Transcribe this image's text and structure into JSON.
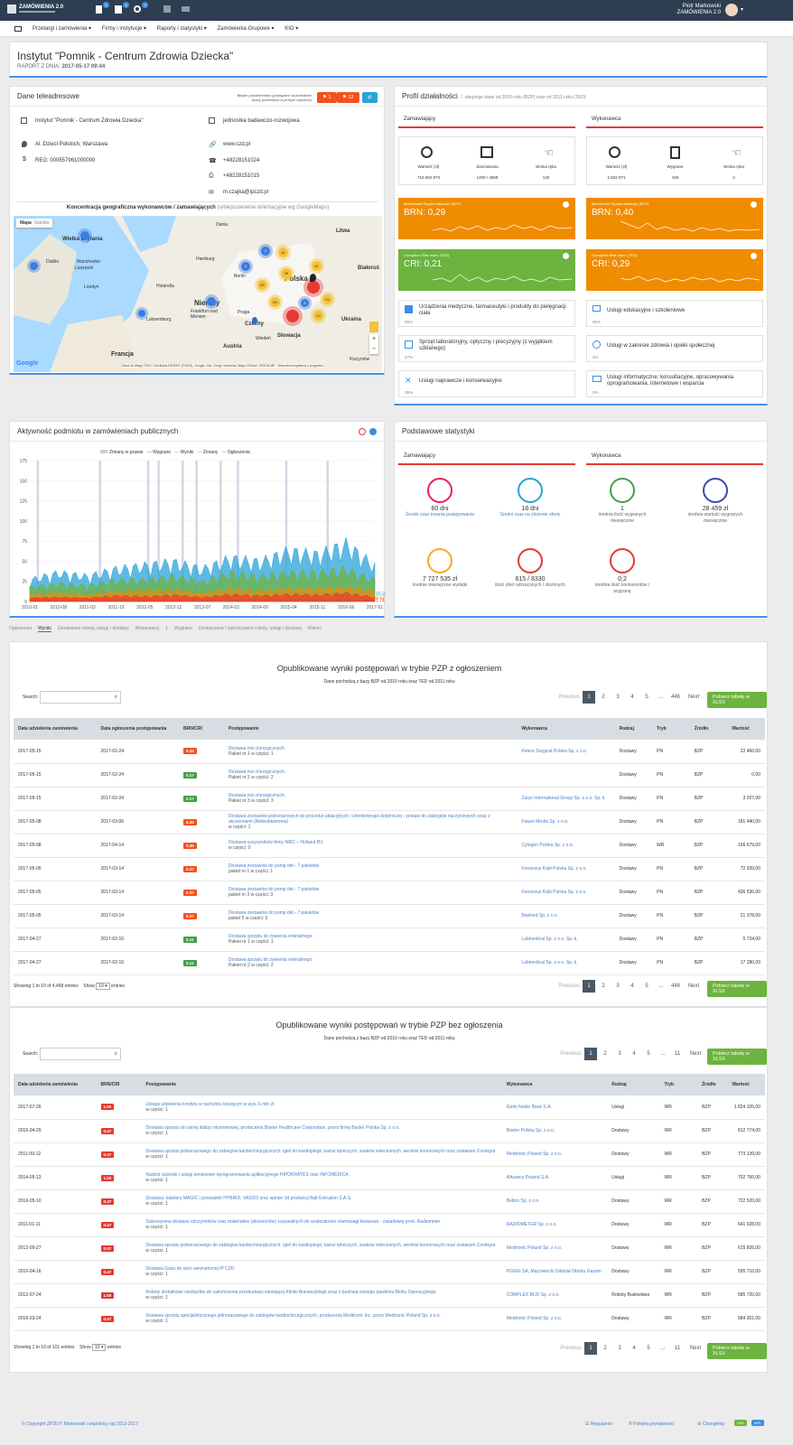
{
  "topbar": {
    "logo": "ZAMÓWIENIA 2.0",
    "user": "Piotr Markowski",
    "user_sub": "ZAMÓWIENIA 2.0",
    "badges": [
      "5",
      "5",
      "9"
    ]
  },
  "nav": [
    "Przetargi i zamówienia",
    "Firmy i instytucje",
    "Raporty i statystyki",
    "Zamówienia Grupowe",
    "KIO"
  ],
  "header": {
    "title": "Instytut \"Pomnik - Centrum Zdrowia Dziecka\"",
    "report_label": "RAPORT Z DNIA:",
    "report_date": "2017-05-17 09:44"
  },
  "contact": {
    "title": "Dane teleadresowe",
    "related_label": "Bliskie podobieństwo (powiązani na podstawie liczby podmiotów w jednym rejestrze)",
    "btn1": "1",
    "btn2": "12",
    "name": "Instytut \"Pomnik - Centrum Zdrowia Dziecka\"",
    "type": "jednostka badawczo-rozwojowa",
    "address": "Al. Dzieci Polskich, Warszawa",
    "www": "www.czd.pl",
    "regon": "REG: 000557961000000",
    "phone": "+48228151024",
    "fax": "+48228151015",
    "email": "m.czajka@ipczd.pl",
    "map_title": "Koncentracja geograficzna wykonawców / zamawiających",
    "map_sub": "(umiejscowienie orientacyjne wg GoogleMaps)",
    "map_tabs": [
      "Mapa",
      "Satelita"
    ],
    "map_labels": [
      "Wielka Brytania",
      "Dublin",
      "Manchester",
      "Liverpool",
      "Londyn",
      "Holandia",
      "Hamburg",
      "Berlin",
      "Niemcy",
      "Frankfurt nad Menem",
      "Praga",
      "Czechy",
      "Polska",
      "Litwa",
      "Białoruś",
      "Słowacja",
      "Austria",
      "Luksemburg",
      "Wiedeń",
      "Ukraina",
      "Kiszyniów",
      "Francja",
      "Dania"
    ],
    "clusters": [
      "2",
      "31",
      "41",
      "38",
      "59",
      "83",
      "24",
      "14",
      "5",
      "2"
    ],
    "google": "Google",
    "map_footer": "Dane do Mapy ©2017 GeoBasis-DE/BKG (©2009), Google, Inst. Geogr. Nacional, Mapa GISrael, ORION-ME · Warunki korzystania z programu"
  },
  "profile": {
    "title": "Profil działalności",
    "subtitle": "obejmuje dane od 2010 roku (BZP) oraz od 2011 roku (TED)",
    "zam": {
      "label": "Zamawiający",
      "stats": [
        {
          "lbl": "Wartość (zł)",
          "val": "715 662 873"
        },
        {
          "lbl": "Zamówienia",
          "val": "1400 / 4559"
        },
        {
          "lbl": "Wolna ręka",
          "val": "125"
        }
      ],
      "brn_label": "Benchmark Ryzyka Naduzyć (BCP)",
      "brn": "BRN: 0,29",
      "cri_label": "Corruption Risk Index (TED)",
      "cri": "CRI: 0,21"
    },
    "wyk": {
      "label": "Wykonawca",
      "stats": [
        {
          "lbl": "Wartość (zł)",
          "val": "2 502 871"
        },
        {
          "lbl": "Wygrane",
          "val": "155"
        },
        {
          "lbl": "Wolna ręka",
          "val": "2"
        }
      ],
      "brn_label": "Benchmark Ryzyka Naduzyć (BCP)",
      "brn": "BRN: 0,40",
      "cri_label": "Corruption Risk Index (TED)",
      "cri": "CRI: 0,29"
    },
    "cats": [
      {
        "name": "Urządzenia medyczne, farmaceutyki i produkty do pielęgnacji ciała",
        "pct": "96%"
      },
      {
        "name": "Usługi edukacyjne i szkoleniowe",
        "pct": "95%"
      },
      {
        "name": "Sprzęt laboratoryjny, optyczny i precyzyjny (z wyjątkiem szklanego)",
        "pct": "47%"
      },
      {
        "name": "Usługi w zakresie zdrowia i opieki społecznej",
        "pct": "2%"
      },
      {
        "name": "Usługi naprawcze i konserwacyjne",
        "pct": "35%"
      },
      {
        "name": "Usługi informatyczne: konsultacyjne, opracowywania oprogramowania, internetowe i wsparcia",
        "pct": "0%"
      }
    ]
  },
  "activity": {
    "title": "Aktywność podmiotu w zamówieniach publicznych",
    "legend": [
      "Zmiany w prawie",
      "Wygrane",
      "Wyniki",
      "Zmiany",
      "Ogłoszenia"
    ],
    "yticks": [
      "175",
      "150",
      "125",
      "100",
      "75",
      "50",
      "25",
      "0"
    ],
    "xticks": [
      "2010-01",
      "2010-08",
      "2011-03",
      "2011-10",
      "2012-05",
      "2012-12",
      "2013-07",
      "2014-02",
      "2014-09",
      "2015-04",
      "2015-11",
      "2016-06",
      "2017-01"
    ],
    "end_labels": [
      "10.22",
      "4.93",
      "1.74"
    ]
  },
  "chart_data": {
    "type": "area",
    "title": "Aktywność podmiotu w zamówieniach publicznych",
    "x": [
      "2010-01",
      "2010-08",
      "2011-03",
      "2011-10",
      "2012-05",
      "2012-12",
      "2013-07",
      "2014-02",
      "2014-09",
      "2015-04",
      "2015-11",
      "2016-06",
      "2017-01"
    ],
    "ylim": [
      0,
      175
    ],
    "series": [
      {
        "name": "Ogłoszenia",
        "values": [
          30,
          40,
          35,
          45,
          50,
          55,
          45,
          60,
          55,
          70,
          65,
          80,
          50
        ]
      },
      {
        "name": "Wyniki",
        "values": [
          20,
          25,
          22,
          30,
          30,
          35,
          28,
          40,
          35,
          40,
          40,
          45,
          30
        ]
      },
      {
        "name": "Zmiany",
        "values": [
          10,
          12,
          10,
          14,
          15,
          16,
          12,
          18,
          15,
          18,
          18,
          20,
          15
        ]
      },
      {
        "name": "Wygrane",
        "values": [
          5,
          6,
          5,
          8,
          7,
          9,
          6,
          10,
          8,
          10,
          9,
          12,
          6
        ]
      }
    ]
  },
  "basic": {
    "title": "Podstawowe statystyki",
    "tabs": [
      "Zamawiający",
      "Wykonawca"
    ],
    "items": [
      {
        "val": "60 dni",
        "lbl": "Średni czas trwania postępowania",
        "link": true,
        "color": "#e91e63"
      },
      {
        "val": "16 dni",
        "lbl": "Średni czas na złożenie oferty",
        "link": true,
        "color": "#29a3d9"
      },
      {
        "val": "1",
        "lbl": "średnia ilość wygranych miesięcznie",
        "link": false,
        "color": "#43a047"
      },
      {
        "val": "28 459 zł",
        "lbl": "średnia wartość wygranych miesięcznie",
        "link": false,
        "color": "#3949ab"
      },
      {
        "val": "7 727 535 zł",
        "lbl": "średnie miesięczne wydatki",
        "link": false,
        "color": "#f9a825"
      },
      {
        "val": "615 / 8330",
        "lbl": "ilość ofert odrzuconych / złożonych",
        "link": false,
        "color": "#e53935"
      },
      {
        "val": "0,2",
        "lbl": "średnia ilość konkurentów / wygraną",
        "link": false,
        "color": "#e53935"
      }
    ]
  },
  "tabs": [
    "Ogłoszenia",
    "Wyniki",
    "Zamawiane roboty, usługi / dostawy",
    "Wykonawcy",
    "1",
    "Wygrane",
    "Dostarczane / wykonywane roboty, usługi / dostawy",
    "Klienci"
  ],
  "table1": {
    "title": "Opublikowane wyniki postępowań w trybie PZP z ogłoszeniem",
    "sub": "Dane pochodzą z bazy BZP od 2010 roku oraz TED od 2011 roku",
    "search": "Search:",
    "pages": [
      "Previous",
      "1",
      "2",
      "3",
      "4",
      "5",
      "...",
      "446",
      "Next"
    ],
    "xlsx": "Pobierz tabelę w XLSX",
    "cols": [
      "Data udzielenia zamówienia",
      "Data ogłoszenia postępowania",
      "BRN/CRI",
      "Postępowanie",
      "Wykonawca",
      "Rodzaj",
      "Tryb",
      "Źródło",
      "Wartość"
    ],
    "rows": [
      [
        "2017-05-15",
        "2017-02-24",
        "0.36",
        "Dostawa nici chirurgicznych.",
        "Pakiet nr 1 w części: 1",
        "Peters Surgical Polska Sp. z o.o.",
        "Dostawy",
        "PN",
        "BZP",
        "22 460,00",
        "or"
      ],
      [
        "2017-05-15",
        "2017-02-24",
        "0.17",
        "Dostawa nici chirurgicznych.",
        "Pakiet nr 2 w części: 2",
        "",
        "Dostawy",
        "PN",
        "BZP",
        "0,00",
        "gr"
      ],
      [
        "2017-05-15",
        "2017-02-24",
        "0.17",
        "Dostawa nici chirurgicznych.",
        "Pakiet nr 3 w części: 3",
        "Zarys International Group Sp. z o.o. Sp. k.",
        "Dostawy",
        "PN",
        "BZP",
        "3 207,00",
        "gr"
      ],
      [
        "2017-05-08",
        "2017-03-06",
        "0.38",
        "Dostawa zestawów jednorazowych do procedur ablacyjnych i chemioterapii dotętniczej - zestaw do zabiegów naczyniowych wraz z akcesoriami (Retinoblastoma)",
        "w części: 1",
        "Future Media Sp. z o.o.",
        "Dostawy",
        "PN",
        "BZP",
        "181 440,00",
        "or"
      ],
      [
        "2017-05-08",
        "2017-04-14",
        "0.39",
        "Dostawa oczyszników firmy MRC – Holland BV.",
        "w części: 0",
        "Cytogen Polska Sp. z o.o.",
        "Dostawy",
        "WR",
        "BZP",
        "156 679,00",
        "or"
      ],
      [
        "2017-05-05",
        "2017-03-14",
        "0.37",
        "Dostawa zestawów do pomp det - 7 pakietów",
        "pakiet nr 1 w części: 1",
        "Fresenius Kabi Polska Sp. z o.o.",
        "Dostawy",
        "PN",
        "BZP",
        "72 939,00",
        "or"
      ],
      [
        "2017-05-05",
        "2017-03-14",
        "0.37",
        "Dostawa zestawów do pomp det - 7 pakietów",
        "pakiet nr 3 w części: 3",
        "Fresenius Kabi Polska Sp. z o.o.",
        "Dostawy",
        "PN",
        "BZP",
        "436 536,00",
        "or"
      ],
      [
        "2017-05-05",
        "2017-03-14",
        "0.37",
        "Dostawa zestawów do pomp det - 7 pakietów",
        "pakiet 5 w części: 5",
        "Bialmed Sp. z o.o.",
        "Dostawy",
        "PN",
        "BZP",
        "21 378,00",
        "or"
      ],
      [
        "2017-04-27",
        "2017-02-16",
        "0.11",
        "Dostawa sprzętu do żywienia enteralnego",
        "Pakiet nr 1 w części: 1",
        "Lubmedical Sp. z o.o. Sp. k.",
        "Dostawy",
        "PN",
        "BZP",
        "5 724,00",
        "gr"
      ],
      [
        "2017-04-27",
        "2017-02-16",
        "0.11",
        "Dostawa sprzętu do żywienia enteralnego",
        "Pakiet nr 2 w części: 2",
        "Lubmedical Sp. z o.o. Sp. k.",
        "Dostawy",
        "PN",
        "BZP",
        "17 280,00",
        "gr"
      ]
    ],
    "info": "Showing 1 to 10 of 4,458 entries",
    "show": "Show",
    "show_val": "10",
    "entries": "entries"
  },
  "table2": {
    "title": "Opublikowane wyniki postępowań w trybie PZP bez ogłoszenia",
    "sub": "Dane pochodzą z bazy BZP od 2010 roku oraz TED od 2011 roku",
    "search": "Search:",
    "pages": [
      "Previous",
      "1",
      "2",
      "3",
      "4",
      "5",
      "...",
      "11",
      "Next"
    ],
    "xlsx": "Pobierz tabelę w XLSX",
    "cols": [
      "Data udzielenia zamówienia",
      "BRN/CRI",
      "Postępowanie",
      "Wykonawca",
      "Rodzaj",
      "Tryb",
      "Źródło",
      "Wartość"
    ],
    "rows": [
      [
        "2017-07-26",
        "1.00",
        "Usługa udzielenia kredytu w rachunku bieżącym w wys. 6 mln zł",
        "w części: 1",
        "Getin Noble Bank S.A.",
        "Usługi",
        "WR",
        "BZP",
        "1 824 105,00"
      ],
      [
        "2015-04-29",
        "0.47",
        "Dostawa sprzętu do ostrej dializy otrzewnowej, producenta Baxter Healthcare Corporation, przez firmę Baxter Polska Sp. z o.o.",
        "w części: 1",
        "Baxter Polska Sp. z o.o.",
        "Dostawy",
        "WR",
        "BZP",
        "812 774,00"
      ],
      [
        "2011-09-12",
        "0.47",
        "Dostawa sprzętu jednorazowego do zabiegów kardiochirurgicznych: igieł do kardioplegii, kaniul tętniczych, ssaków wierceonych, wentów komorowych oraz zestawek Contegra",
        "w części: 1",
        "Medtronic Poland Sp. z o.o.",
        "Dostawy",
        "WR",
        "BZP",
        "773 139,00"
      ],
      [
        "2014-05-13",
        "1.00",
        "Nadzór autorski i usługi serwisowe oprogramowania aplikacyjnego HIPOKRATES oraz INFOMEDICA",
        "w części: 1",
        "AAsseco Poland S.A.",
        "Usługi",
        "WR",
        "BZP",
        "752 760,00"
      ],
      [
        "2016-05-10",
        "0.47",
        "Dostawa: katetery MAGIC i prowadnik HYBRID, VASCO oraz spirale 3d produkcji Balt Extrusion S.A.S.",
        "w części: 1",
        "Belton Sp. z o.o.",
        "Dostawy",
        "WR",
        "BZP",
        "722 520,00"
      ],
      [
        "2011-01-11",
        "0.47",
        "Sukcesywna dostawa odczynników oraz materiałów (akcesoriów) zużywalnych do analizatorów równowagi kwasowo - zasadowej prod. Radiometer",
        "w części: 1",
        "RADIOMETER Sp. z o.o.",
        "Dostawy",
        "WR",
        "BZP",
        "641 028,00"
      ],
      [
        "2012-09-27",
        "0.47",
        "Dostawa sprzętu jednorazowego do zabiegów kardiochirurgicznych: igieł do kardioplegii, kaniul tętniczych, ssaków wierceonych, wentów komorowych oraz zestawek Contegra",
        "w części: 1",
        "Medtronic Poland Sp. z o.o.",
        "Dostawy",
        "WR",
        "BZP",
        "615 826,00"
      ],
      [
        "2016-04-16",
        "0.47",
        "Dostawa Gazu do sieci wewnętrznej IP CZD",
        "w części: 1",
        "PGNiG SA, Mazowiecki Oddział Obrotu Gazem",
        "Dostawy",
        "WR",
        "BZP",
        "595 710,00"
      ],
      [
        "2012-07-24",
        "1.00",
        "Roboty dodatkowe niezbędne do zakończenia przebudowy istniejącej Kliniki Anestezjologii wraz z budową nowego pawilonu Bloku Operacyjnego",
        "w części: 1",
        "COMPLEX BUD Sp. z o.o.",
        "Roboty Budowlane",
        "WR",
        "BZP",
        "585 720,00"
      ],
      [
        "2016-03-24",
        "0.47",
        "Dostawa sprzętu specjalistycznego jednorazowego do zabiegów kardiochirurgicznych, producenta Medtronic Inc. przez Medtronic Poland Sp. z o.o.",
        "w części: 1",
        "Medtronic Poland Sp. z o.o.",
        "Dostawy",
        "WR",
        "BZP",
        "584 301,00"
      ]
    ],
    "info": "Showing 1 to 10 of 101 entries",
    "show": "Show",
    "show_val": "10",
    "entries": "entries"
  },
  "footer": {
    "copy": "© Copyright ZP20 P. Markowski i wspólnicy spj 2013-2017",
    "links": [
      "Regulamin",
      "Polityka prywatności",
      "Changelog"
    ],
    "badges": [
      "VAS",
      "MRL"
    ]
  }
}
